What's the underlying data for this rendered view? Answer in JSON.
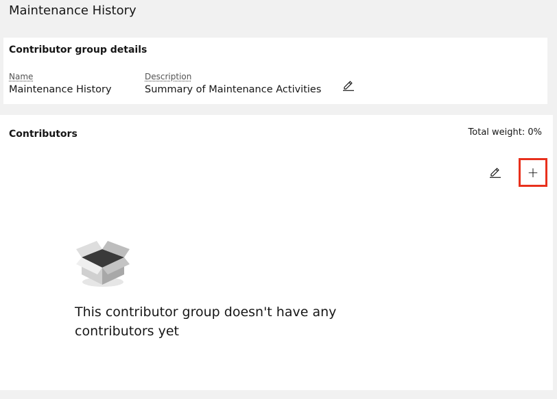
{
  "page": {
    "title": "Maintenance History"
  },
  "details": {
    "title": "Contributor group details",
    "name_label": "Name",
    "name_value": "Maintenance History",
    "description_label": "Description",
    "description_value": "Summary of Maintenance Activities",
    "edit_icon": "pencil-icon"
  },
  "contributors": {
    "title": "Contributors",
    "total_weight": "Total weight: 0%",
    "edit_icon": "pencil-icon",
    "add_icon": "plus-icon",
    "add_symbol": "+",
    "empty_illustration": "empty-box-icon",
    "empty_message": "This contributor group doesn't have any contributors yet"
  },
  "colors": {
    "background": "#f1f1f1",
    "card": "#ffffff",
    "highlight": "#e8301c",
    "text": "#161616"
  }
}
